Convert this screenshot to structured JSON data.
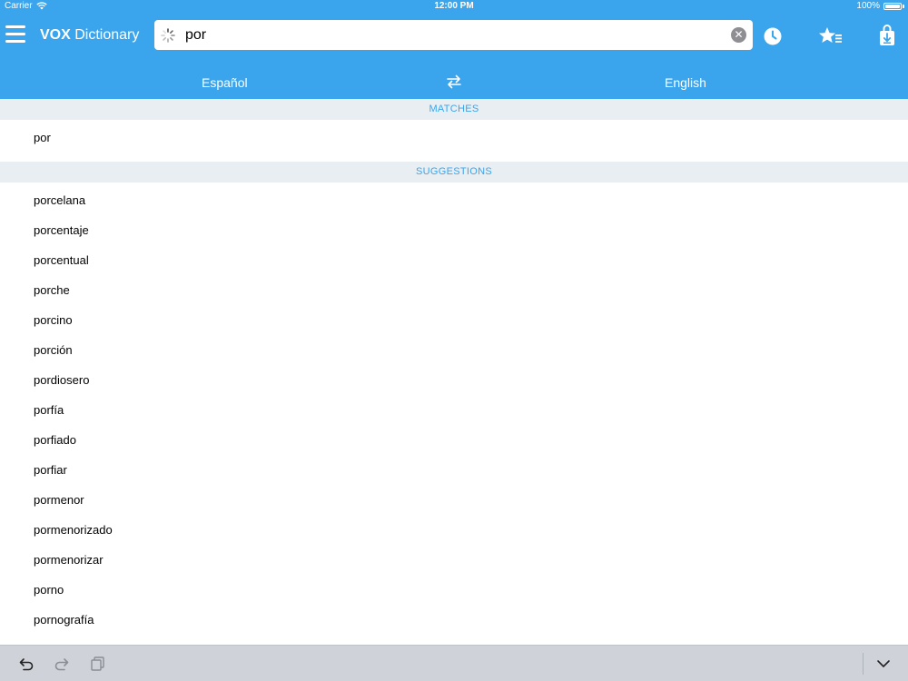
{
  "status_bar": {
    "carrier": "Carrier",
    "time": "12:00 PM",
    "battery": "100%"
  },
  "header": {
    "title_bold": "VOX",
    "title_rest": " Dictionary",
    "search_value": "por",
    "icons": [
      "menu-icon",
      "spinner-icon",
      "clear-icon",
      "history-icon",
      "favorites-icon",
      "download-icon"
    ]
  },
  "languages": {
    "source": "Español",
    "target": "English",
    "swap_icon": "swap-arrows-icon"
  },
  "matches": {
    "header": "MATCHES",
    "items": [
      "por"
    ]
  },
  "suggestions": {
    "header": "SUGGESTIONS",
    "items": [
      "porcelana",
      "porcentaje",
      "porcentual",
      "porche",
      "porcino",
      "porción",
      "pordiosero",
      "porfía",
      "porfiado",
      "porfiar",
      "pormenor",
      "pormenorizado",
      "pormenorizar",
      "porno",
      "pornografía"
    ]
  },
  "toolbar": {
    "icons": [
      "undo-icon",
      "redo-icon",
      "paste-icon",
      "keyboard-dismiss-icon"
    ]
  },
  "colors": {
    "accent": "#3aa5ec",
    "section_bg": "#e9eef2",
    "toolbar_bg": "#cfd3d9"
  }
}
